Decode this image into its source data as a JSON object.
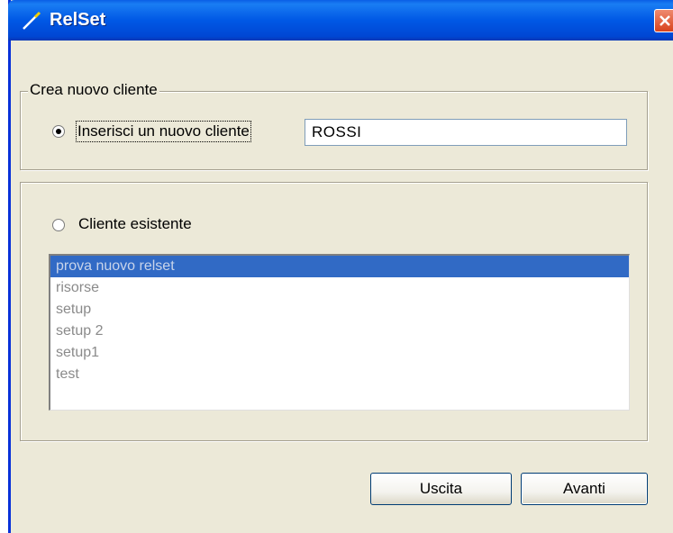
{
  "window": {
    "title": "RelSet"
  },
  "new_client": {
    "legend": "Crea nuovo cliente",
    "radio_label": "Inserisci un nuovo cliente",
    "radio_checked": true,
    "input_value": "ROSSI"
  },
  "existing_client": {
    "radio_label": "Cliente esistente",
    "radio_checked": false,
    "items": [
      "prova nuovo relset",
      "risorse",
      "setup",
      "setup 2",
      "setup1",
      "test"
    ],
    "selected_index": 0
  },
  "buttons": {
    "exit_label": "Uscita",
    "next_label": "Avanti"
  },
  "colors": {
    "titlebar": "#0058e5",
    "selection": "#316ac5",
    "face": "#ece9d8"
  }
}
